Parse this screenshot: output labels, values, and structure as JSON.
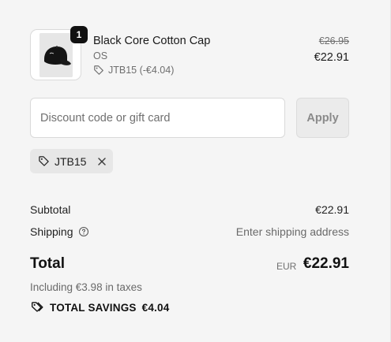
{
  "line_item": {
    "quantity": "1",
    "title": "Black Core Cotton Cap",
    "variant": "OS",
    "discount_label": "JTB15 (-€4.04)",
    "compare_price": "€26.95",
    "price": "€22.91",
    "thumbnail_icon": "black-cap-product-image"
  },
  "discount_form": {
    "placeholder": "Discount code or gift card",
    "value": "",
    "apply_label": "Apply"
  },
  "applied_code": {
    "code": "JTB15",
    "remove_icon": "close-icon"
  },
  "totals": {
    "subtotal_label": "Subtotal",
    "subtotal_value": "€22.91",
    "shipping_label": "Shipping",
    "shipping_value": "Enter shipping address",
    "total_label": "Total",
    "currency": "EUR",
    "total_value": "€22.91",
    "tax_note": "Including €3.98 in taxes",
    "savings_label": "TOTAL SAVINGS",
    "savings_value": "€4.04"
  },
  "colors": {
    "background": "#f5f5f5",
    "text": "#1f1f1f",
    "muted": "#6e6e6e",
    "badge": "#111111"
  }
}
